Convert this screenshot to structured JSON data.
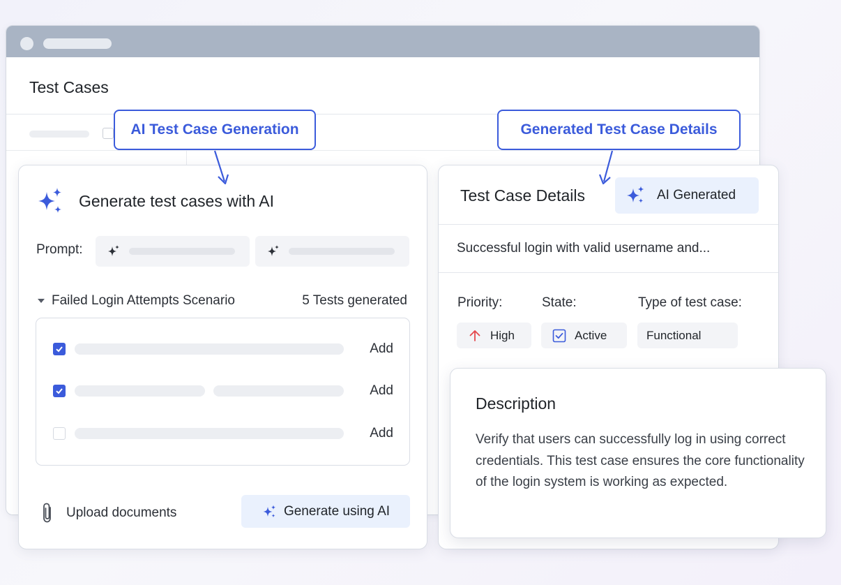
{
  "window": {
    "title": "Test Cases"
  },
  "callouts": {
    "left": "AI Test Case Generation",
    "right": "Generated Test Case Details"
  },
  "generator": {
    "title": "Generate test cases with AI",
    "prompt_label": "Prompt:",
    "scenario": "Failed Login Attempts Scenario",
    "tests_count": "5 Tests generated",
    "rows": [
      {
        "checked": true,
        "action": "Add"
      },
      {
        "checked": true,
        "action": "Add"
      },
      {
        "checked": false,
        "action": "Add"
      }
    ],
    "upload_label": "Upload documents",
    "generate_label": "Generate using AI"
  },
  "details": {
    "title": "Test Case Details",
    "badge": "AI Generated",
    "summary": "Successful login with valid username and...",
    "priority_label": "Priority:",
    "state_label": "State:",
    "type_label": "Type of test case:",
    "priority_value": "High",
    "state_value": "Active",
    "type_value": "Functional"
  },
  "description": {
    "title": "Description",
    "body": "Verify that users can successfully log in using correct credentials. This test case ensures the core functionality of the login system is working as expected."
  },
  "colors": {
    "accent": "#3b5bdb",
    "badge_bg": "#eaf1fd",
    "titlebar": "#a9b4c4",
    "priority_high": "#e5484d"
  },
  "icons": {
    "sparkle": "sparkle-icon",
    "clip": "paperclip-icon",
    "priority": "arrow-up-icon",
    "state": "checkbox-icon"
  }
}
